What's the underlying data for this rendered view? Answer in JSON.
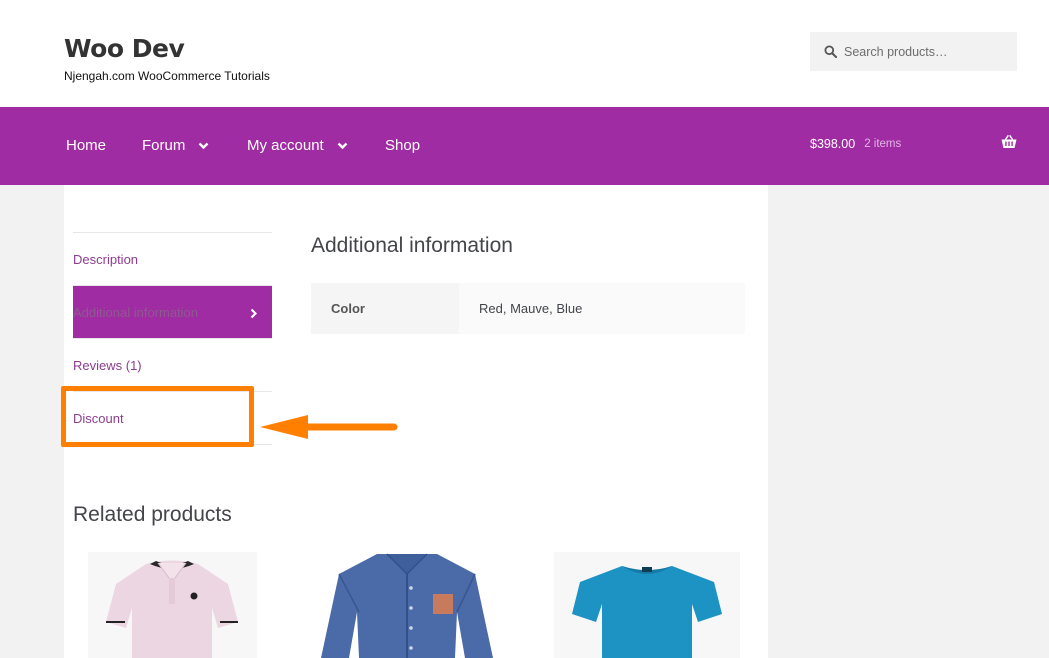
{
  "header": {
    "site_title": "Woo Dev",
    "tagline": "Njengah.com WooCommerce Tutorials",
    "search_placeholder": "Search products…"
  },
  "nav": {
    "items": [
      {
        "label": "Home",
        "has_dropdown": false
      },
      {
        "label": "Forum",
        "has_dropdown": true
      },
      {
        "label": "My account",
        "has_dropdown": true
      },
      {
        "label": "Shop",
        "has_dropdown": false
      }
    ],
    "cart_total": "$398.00",
    "cart_count": "2 items",
    "cart_icon": "basket-icon"
  },
  "tabs": [
    {
      "label": "Description",
      "active": false
    },
    {
      "label": "Additional information",
      "active": true
    },
    {
      "label": "Reviews (1)",
      "active": false
    },
    {
      "label": "Discount",
      "active": false
    }
  ],
  "panel": {
    "title": "Additional information",
    "attributes": [
      {
        "label": "Color",
        "value": "Red, Mauve, Blue"
      }
    ]
  },
  "related": {
    "title": "Related products",
    "products": [
      {
        "image": "pink-polo-shirt"
      },
      {
        "image": "blue-denim-shirt"
      },
      {
        "image": "blue-t-shirt"
      }
    ]
  },
  "annotation": {
    "highlight_color": "#ff8000"
  },
  "colors": {
    "primary": "#a02ca3",
    "link": "#8d3d8f",
    "text": "#43454b"
  }
}
